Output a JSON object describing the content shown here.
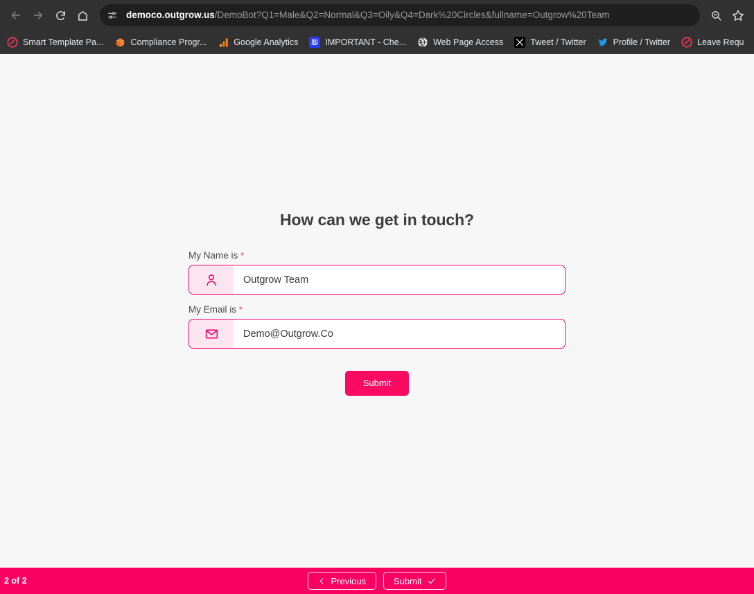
{
  "browser": {
    "nav": {
      "back_tooltip": "Back",
      "forward_tooltip": "Forward",
      "reload_tooltip": "Reload",
      "home_tooltip": "Home"
    },
    "omnibox": {
      "site_info_icon": "page-settings-icon",
      "url_host": "democo.outgrow.us",
      "url_path": "/DemoBot?Q1=Male&Q2=Normal&Q3=Oily&Q4=Dark%20Circles&fullname=Outgrow%20Team",
      "full_url": "democo.outgrow.us/DemoBot?Q1=Male&Q2=Normal&Q3=Oily&Q4=Dark%20Circles&fullname=Outgrow%20Team"
    },
    "actions": [
      {
        "name": "zoom-out-icon",
        "tooltip": "Zoom out"
      },
      {
        "name": "bookmark-star-icon",
        "tooltip": "Bookmark this tab"
      }
    ],
    "bookmarks": [
      {
        "label": "Smart Template Pa...",
        "icon": "outgrow-logo-icon",
        "color": "#f2385a"
      },
      {
        "label": "Compliance Progr...",
        "icon": "orange-cube-icon",
        "color": "#f0682a"
      },
      {
        "label": "Google Analytics",
        "icon": "analytics-bars-icon",
        "color": "#f59b23"
      },
      {
        "label": "IMPORTANT - Che...",
        "icon": "blue-square-icon",
        "color": "#2b3af5"
      },
      {
        "label": "Web Page Access",
        "icon": "globe-icon",
        "color": "#ffffff"
      },
      {
        "label": "Tweet / Twitter",
        "icon": "x-logo-icon",
        "color": "#000000"
      },
      {
        "label": "Profile / Twitter",
        "icon": "twitter-bird-icon",
        "color": "#1d9bf0"
      },
      {
        "label": "Leave Requ",
        "icon": "outgrow-logo-icon",
        "color": "#f2385a"
      }
    ]
  },
  "page": {
    "title": "How can we get in touch?",
    "fields": [
      {
        "label": "My Name is",
        "required_marker": "*",
        "icon": "person-icon",
        "value": "Outgrow Team",
        "placeholder": "My Name is"
      },
      {
        "label": "My Email is",
        "required_marker": "*",
        "icon": "envelope-icon",
        "value": "Demo@Outgrow.Co",
        "placeholder": "My Email is"
      }
    ],
    "submit_label": "Submit",
    "bottom_bar": {
      "page_counter": "2 of 2",
      "previous_label": "Previous",
      "submit_label": "Submit",
      "previous_icon": "chevron-left-icon",
      "submit_icon": "check-icon"
    },
    "colors": {
      "accent": "#fa0060",
      "accent_button": "#fa0a61",
      "field_border": "#f5056e",
      "icon_box_bg": "#fde6ef",
      "background": "#f7f7f7",
      "required_star": "#ff3b30"
    }
  }
}
